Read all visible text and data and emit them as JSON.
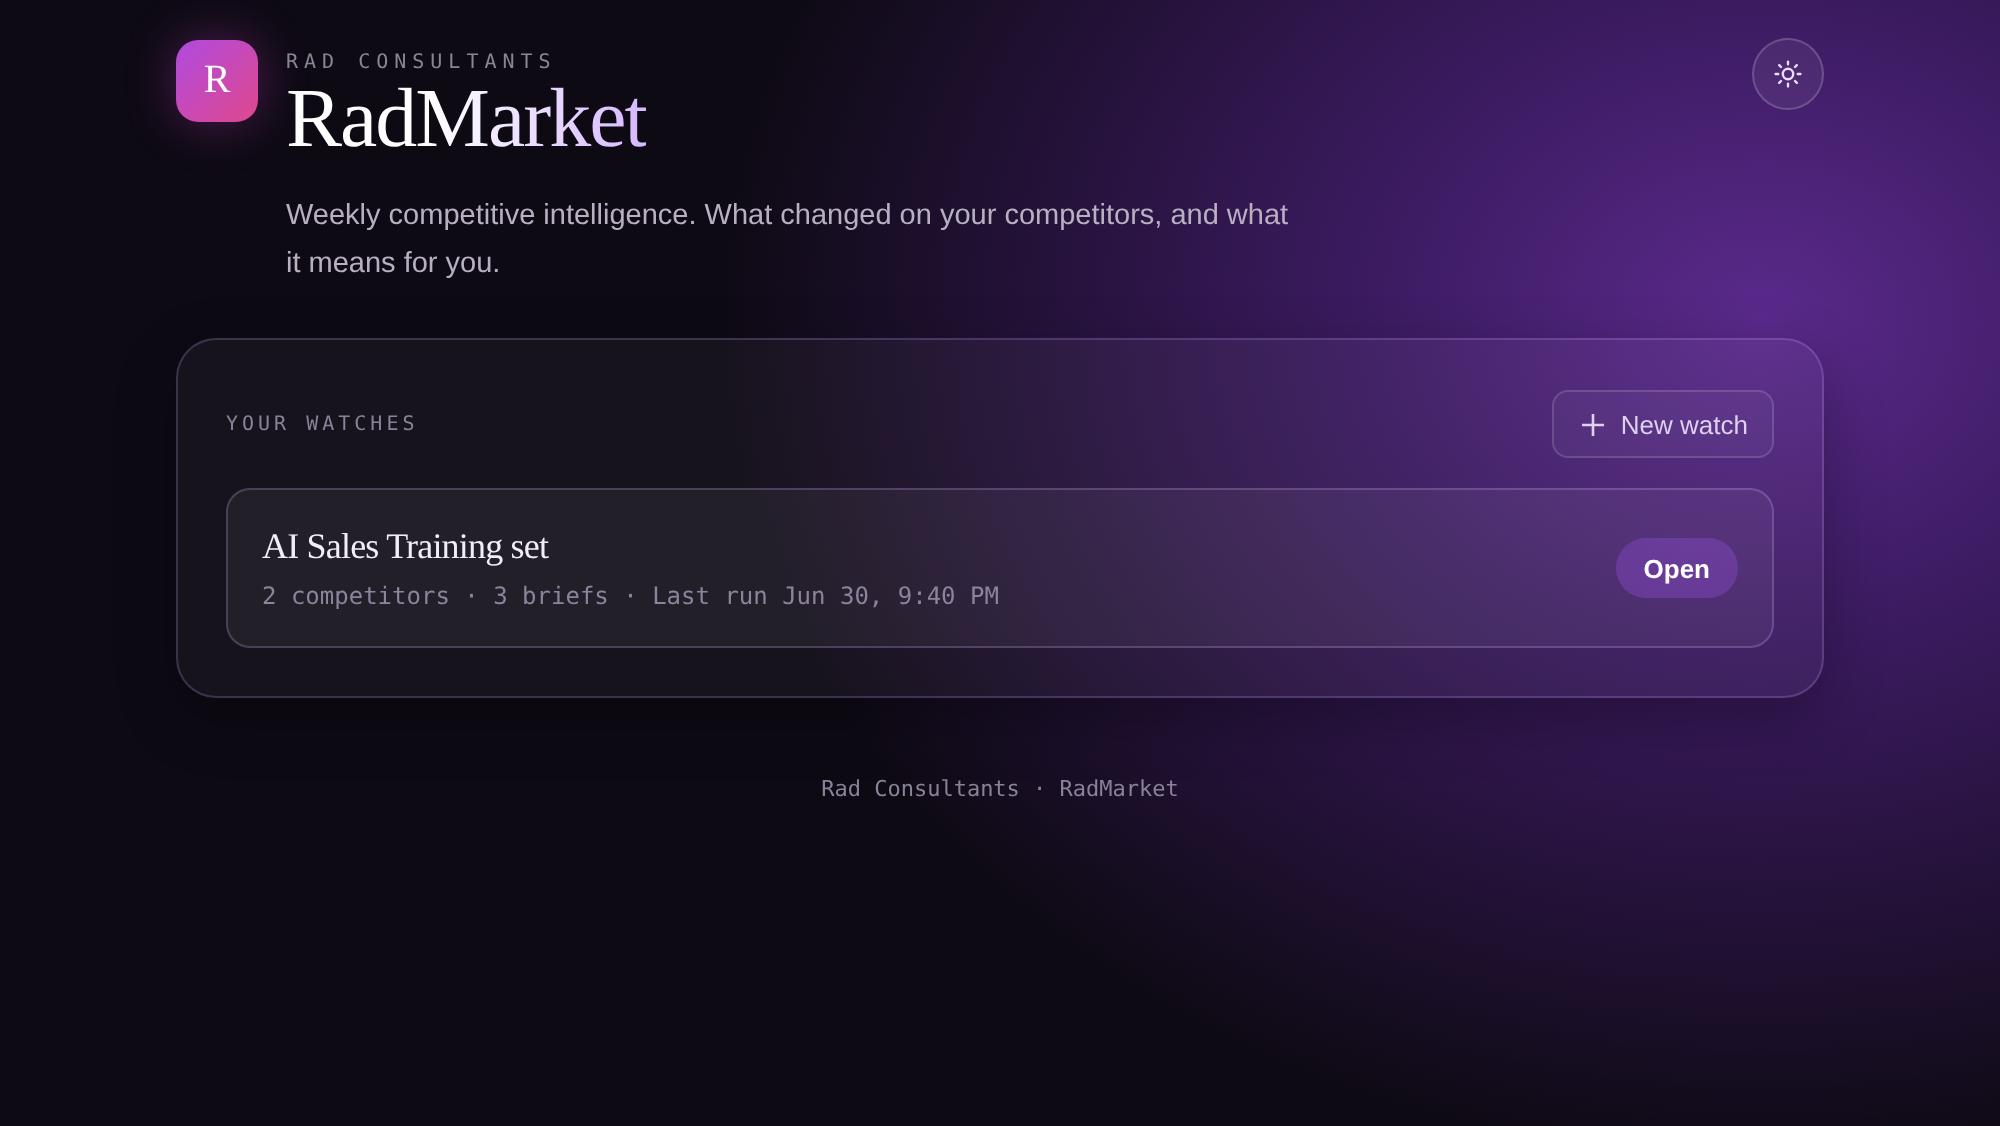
{
  "brand": {
    "logo_letter": "R",
    "company": "RAD CONSULTANTS",
    "title": "RadMarket",
    "tagline": "Weekly competitive intelligence. What changed on your competitors, and what it means for you."
  },
  "watches": {
    "heading": "YOUR WATCHES",
    "new_button": "New watch",
    "items": [
      {
        "name": "AI Sales Training set",
        "meta": "2 competitors · 3 briefs · Last run Jun 30, 9:40 PM",
        "action": "Open"
      }
    ]
  },
  "footer": "Rad Consultants · RadMarket"
}
